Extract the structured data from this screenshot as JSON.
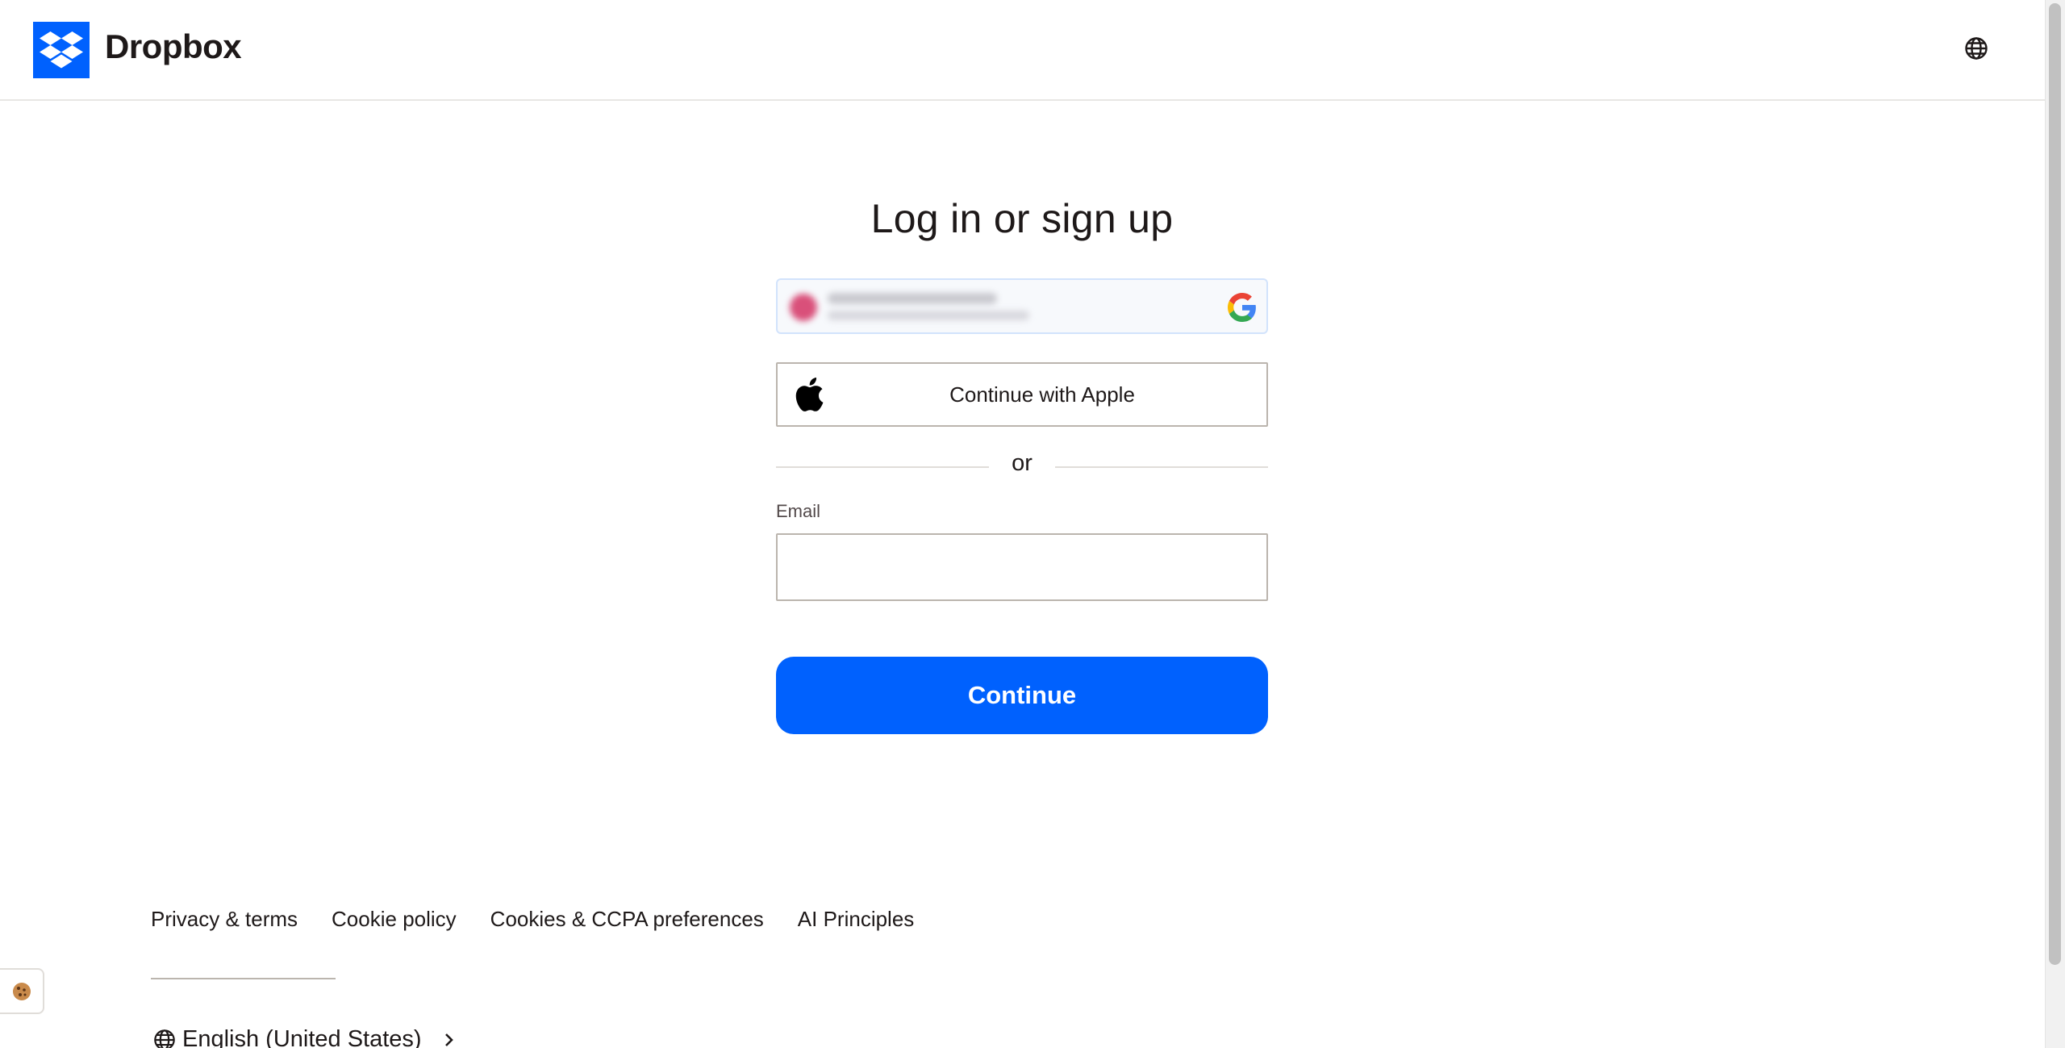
{
  "header": {
    "brand_name": "Dropbox",
    "logo_icon": "dropbox-logo-icon",
    "language_icon": "globe-icon",
    "brand_color": "#0061fe"
  },
  "main": {
    "title": "Log in or sign up",
    "google_button": {
      "icon": "google-icon"
    },
    "apple_button": {
      "label": "Continue with Apple",
      "icon": "apple-icon"
    },
    "divider_text": "or",
    "email": {
      "label": "Email",
      "value": "",
      "placeholder": ""
    },
    "continue_label": "Continue",
    "continue_color": "#0061fe"
  },
  "footer": {
    "links": [
      {
        "label": "Privacy & terms"
      },
      {
        "label": "Cookie policy"
      },
      {
        "label": "Cookies & CCPA preferences"
      },
      {
        "label": "AI Principles"
      }
    ],
    "language": {
      "label": "English (United States)",
      "icon": "globe-icon",
      "chevron_icon": "chevron-right-icon"
    },
    "cookie_icon": "cookie-icon"
  }
}
